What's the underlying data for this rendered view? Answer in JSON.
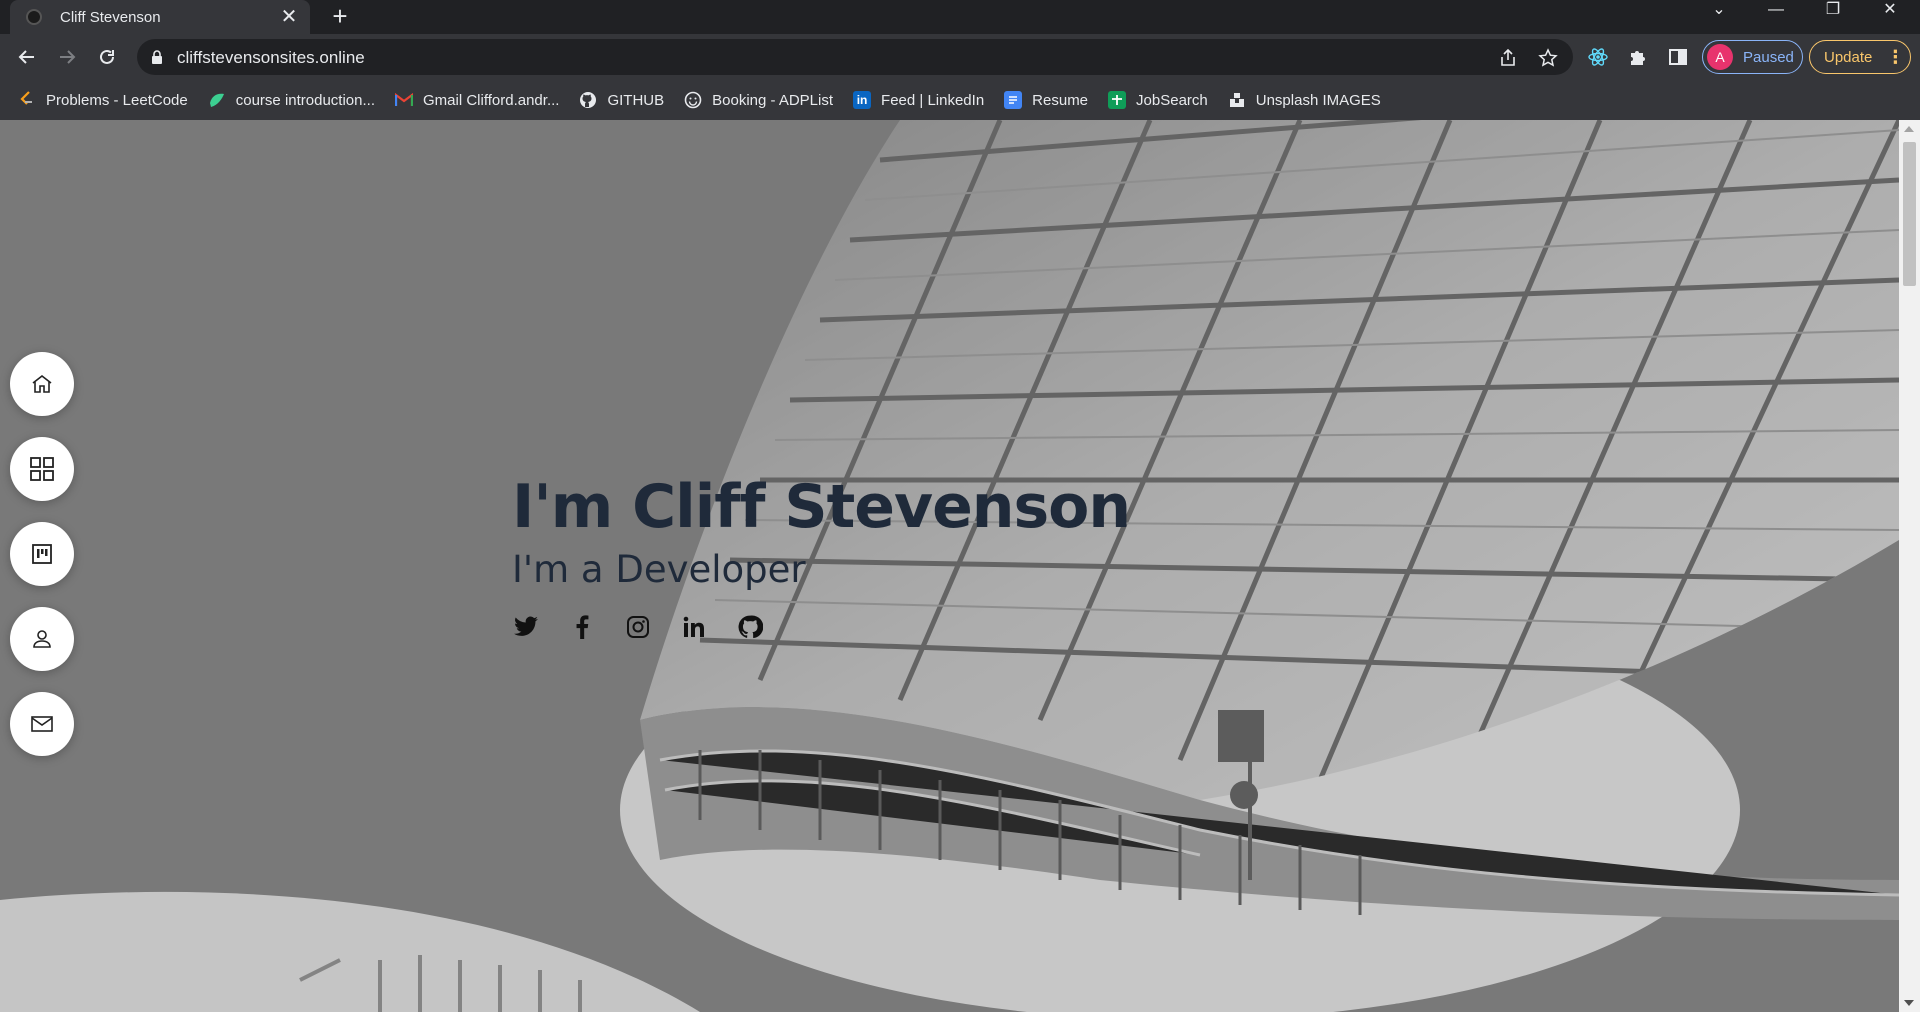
{
  "browser": {
    "tab": {
      "title": "Cliff Stevenson",
      "close": "✕"
    },
    "new_tab": "+",
    "url": "cliffstevensonsites.online",
    "profile": {
      "initial": "A",
      "status": "Paused"
    },
    "update": {
      "label": "Update",
      "menu": "⋮"
    },
    "window_controls": {
      "tabsearch": "⌄",
      "minimize": "—",
      "restore": "❐",
      "close": "✕"
    },
    "bookmarks": [
      {
        "label": "Problems - LeetCode",
        "icon": "leetcode-icon"
      },
      {
        "label": "course introduction...",
        "icon": "course-icon"
      },
      {
        "label": "Gmail Clifford.andr...",
        "icon": "gmail-icon"
      },
      {
        "label": "GITHUB",
        "icon": "github-icon"
      },
      {
        "label": "Booking - ADPList",
        "icon": "adplist-icon"
      },
      {
        "label": "Feed | LinkedIn",
        "icon": "linkedin-icon"
      },
      {
        "label": "Resume",
        "icon": "docs-icon"
      },
      {
        "label": "JobSearch",
        "icon": "sheets-icon"
      },
      {
        "label": "Unsplash IMAGES",
        "icon": "unsplash-icon"
      }
    ]
  },
  "page": {
    "side_nav": [
      "home-icon",
      "grid-icon",
      "kanban-icon",
      "user-icon",
      "mail-icon"
    ],
    "hero": {
      "name": "I'm Cliff Stevenson",
      "role": "I'm a Developer"
    },
    "socials": [
      "twitter-icon",
      "facebook-icon",
      "instagram-icon",
      "linkedin-icon",
      "github-icon"
    ]
  },
  "colors": {
    "heading": "#1f2a3a",
    "browser_frame": "#35363a",
    "profile_accent": "#8ab4f8",
    "update_accent": "#f9c66b"
  }
}
